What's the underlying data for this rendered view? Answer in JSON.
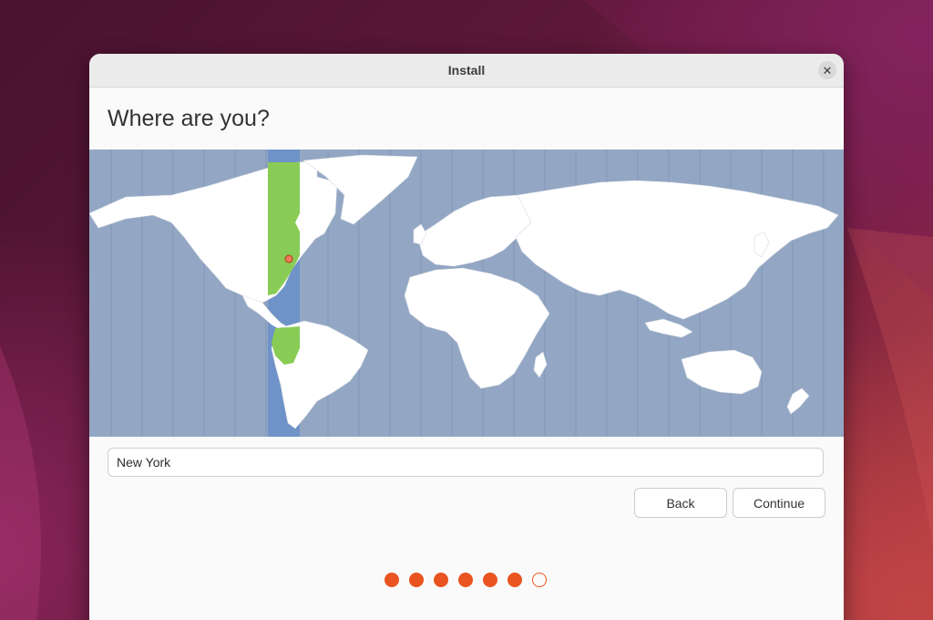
{
  "window": {
    "title": "Install",
    "close_icon": "close-icon"
  },
  "page": {
    "heading": "Where are you?"
  },
  "map": {
    "selected_timezone": "New York",
    "land_color": "#ffffff",
    "water_color": "#93a7c4",
    "highlight_color": "#88cc55",
    "marker_color": "#e95420"
  },
  "location": {
    "value": "New York"
  },
  "buttons": {
    "back": "Back",
    "continue": "Continue"
  },
  "progress": {
    "completed_steps": 6,
    "total_steps": 7,
    "accent": "#e95420"
  }
}
